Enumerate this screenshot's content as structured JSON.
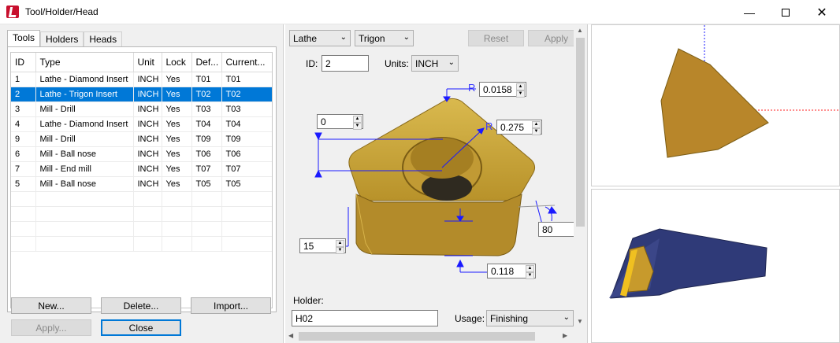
{
  "window": {
    "title": "Tool/Holder/Head"
  },
  "tabs": [
    "Tools",
    "Holders",
    "Heads"
  ],
  "table": {
    "columns": [
      "ID",
      "Type",
      "Unit",
      "Lock",
      "Def...",
      "Current..."
    ],
    "rows": [
      [
        "1",
        "Lathe - Diamond Insert",
        "INCH",
        "Yes",
        "T01",
        "T01"
      ],
      [
        "2",
        "Lathe - Trigon Insert",
        "INCH",
        "Yes",
        "T02",
        "T02"
      ],
      [
        "3",
        "Mill - Drill",
        "INCH",
        "Yes",
        "T03",
        "T03"
      ],
      [
        "4",
        "Lathe - Diamond Insert",
        "INCH",
        "Yes",
        "T04",
        "T04"
      ],
      [
        "9",
        "Mill - Drill",
        "INCH",
        "Yes",
        "T09",
        "T09"
      ],
      [
        "6",
        "Mill - Ball nose",
        "INCH",
        "Yes",
        "T06",
        "T06"
      ],
      [
        "7",
        "Mill - End mill",
        "INCH",
        "Yes",
        "T07",
        "T07"
      ],
      [
        "5",
        "Mill - Ball nose",
        "INCH",
        "Yes",
        "T05",
        "T05"
      ]
    ],
    "selected_index": 1
  },
  "buttons": {
    "new": "New...",
    "delete": "Delete...",
    "import": "Import...",
    "apply_left": "Apply...",
    "close": "Close",
    "reset": "Reset",
    "apply_right": "Apply"
  },
  "editor": {
    "type_select": "Lathe",
    "shape_select": "Trigon",
    "id_label": "ID:",
    "id_value": "2",
    "units_label": "Units:",
    "units_value": "INCH",
    "r_label": "R",
    "corner_radius": "0.0158",
    "inscribed_radius": "0.275",
    "top_offset": "0",
    "relief_angle": "15",
    "side_angle": "80",
    "thickness": "0.118",
    "holder_label": "Holder:",
    "holder_value": "H02",
    "usage_label": "Usage:",
    "usage_value": "Finishing"
  },
  "colors": {
    "selection": "#0078d7",
    "insert_gold": "#c9a53a",
    "dimension_blue": "#1a1aff",
    "holder_navy": "#2f3a78"
  }
}
